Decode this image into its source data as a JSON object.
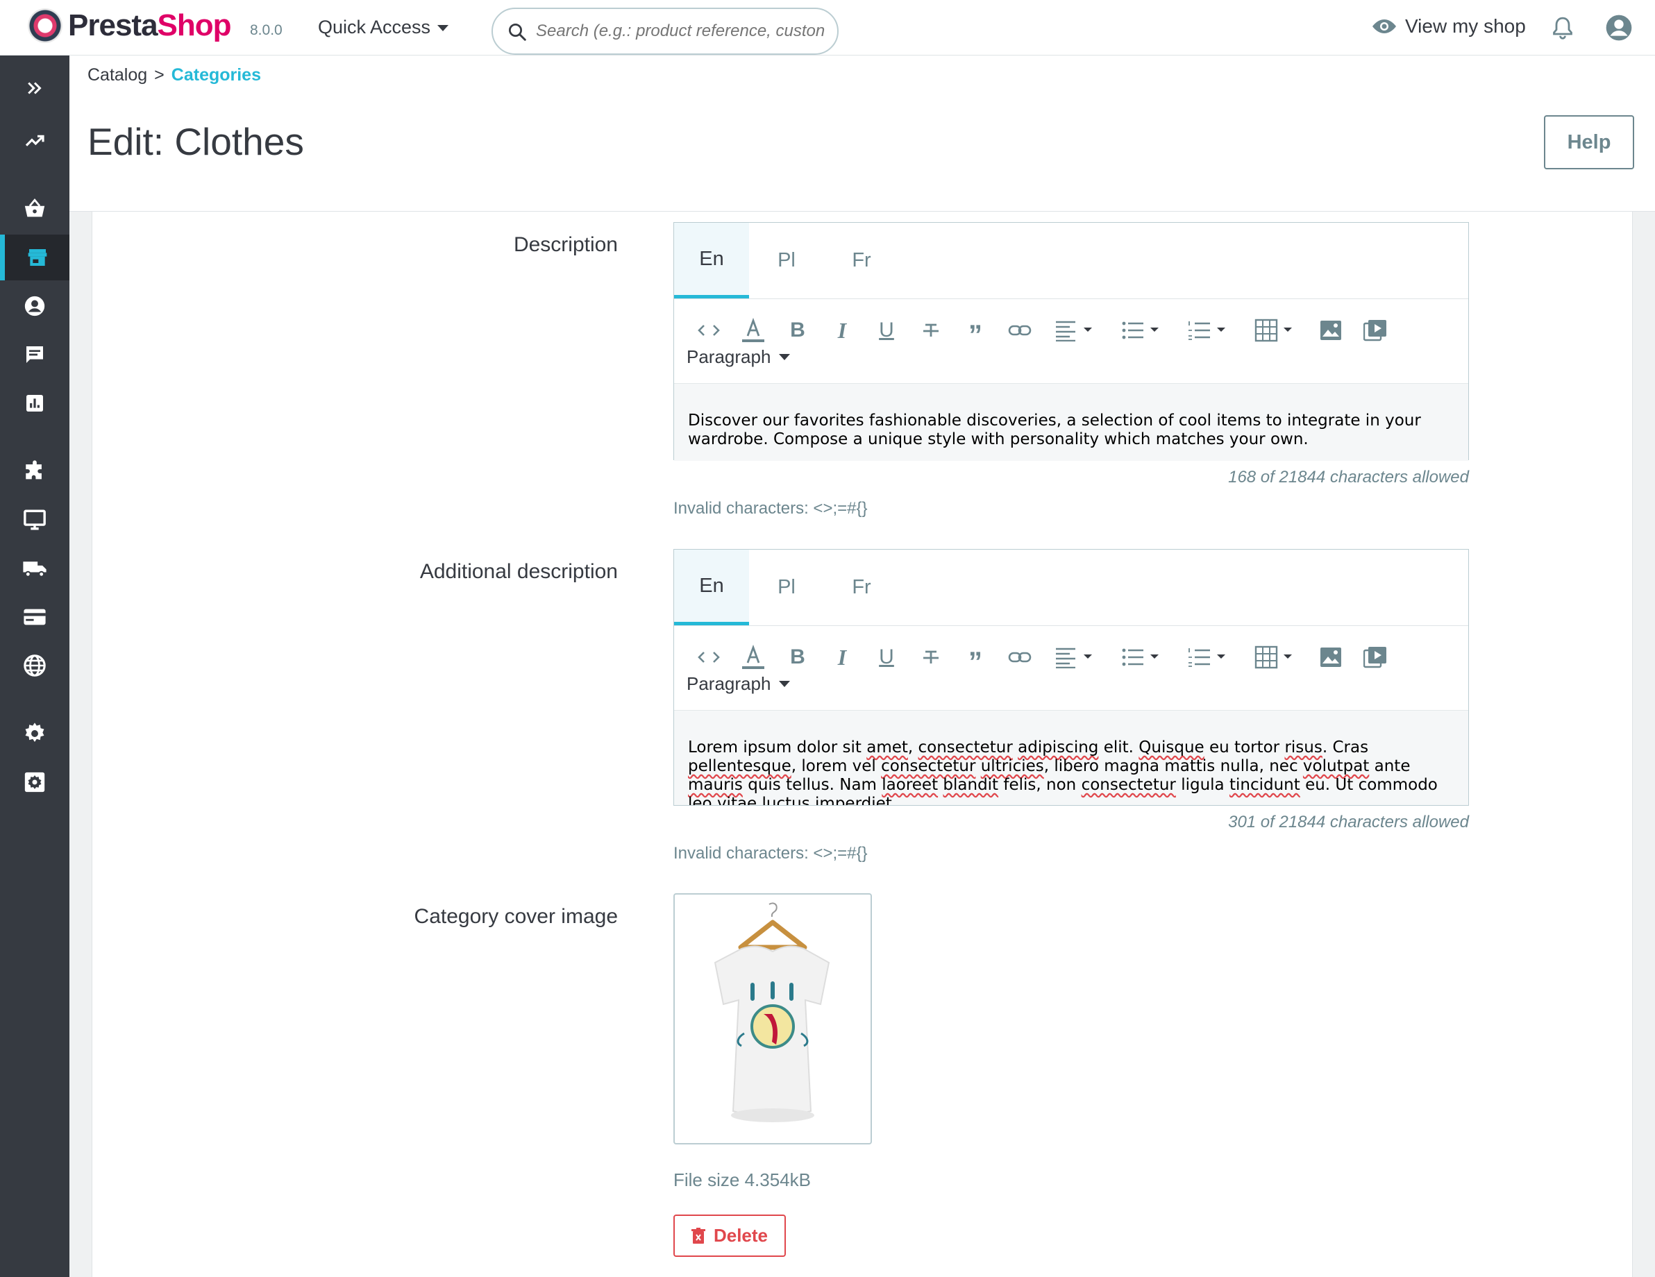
{
  "topbar": {
    "logo_text_a": "Presta",
    "logo_text_b": "Shop",
    "version": "8.0.0",
    "quick_access": "Quick Access",
    "search_placeholder": "Search (e.g.: product reference, custon",
    "view_shop": "View my shop"
  },
  "breadcrumb": {
    "parent": "Catalog",
    "separator": ">",
    "current": "Categories"
  },
  "page_title": "Edit: Clothes",
  "help_label": "Help",
  "sidebar": {
    "items": [
      "expand-icon",
      "stats-trend-icon",
      "orders-basket-icon",
      "catalog-store-icon",
      "customers-icon",
      "messages-icon",
      "stats-icon",
      "modules-icon",
      "design-icon",
      "shipping-icon",
      "payment-icon",
      "international-icon",
      "settings-icon",
      "advanced-settings-icon"
    ],
    "active": "catalog-store-icon",
    "accent": "#25b9d7"
  },
  "fields": {
    "description": {
      "label": "Description",
      "tabs": [
        "En",
        "Pl",
        "Fr"
      ],
      "active_tab": "En",
      "format": "Paragraph",
      "text": "Discover our favorites fashionable discoveries, a selection of cool items to integrate in your wardrobe. Compose a unique style with personality which matches your own.",
      "counter": "168 of 21844 characters allowed",
      "invalid": "Invalid characters: <>;=#{}"
    },
    "additional_description": {
      "label": "Additional description",
      "tabs": [
        "En",
        "Pl",
        "Fr"
      ],
      "active_tab": "En",
      "format": "Paragraph",
      "text": "Lorem ipsum dolor sit amet, consectetur adipiscing elit. Quisque eu tortor risus. Cras pellentesque, lorem vel consectetur ultricies, libero magna mattis nulla, nec volutpat ante mauris quis tellus. Nam laoreet blandit felis, non consectetur ligula tincidunt eu. Ut commodo leo vitae luctus imperdiet.",
      "counter": "301 of 21844 characters allowed",
      "invalid": "Invalid characters: <>;=#{}"
    },
    "cover_image": {
      "label": "Category cover image",
      "file_size": "File size 4.354kB",
      "delete_label": "Delete"
    }
  },
  "colors": {
    "accent": "#25b9d7",
    "danger": "#e0474c",
    "sidebar": "#363a41",
    "muted": "#6c868e"
  }
}
